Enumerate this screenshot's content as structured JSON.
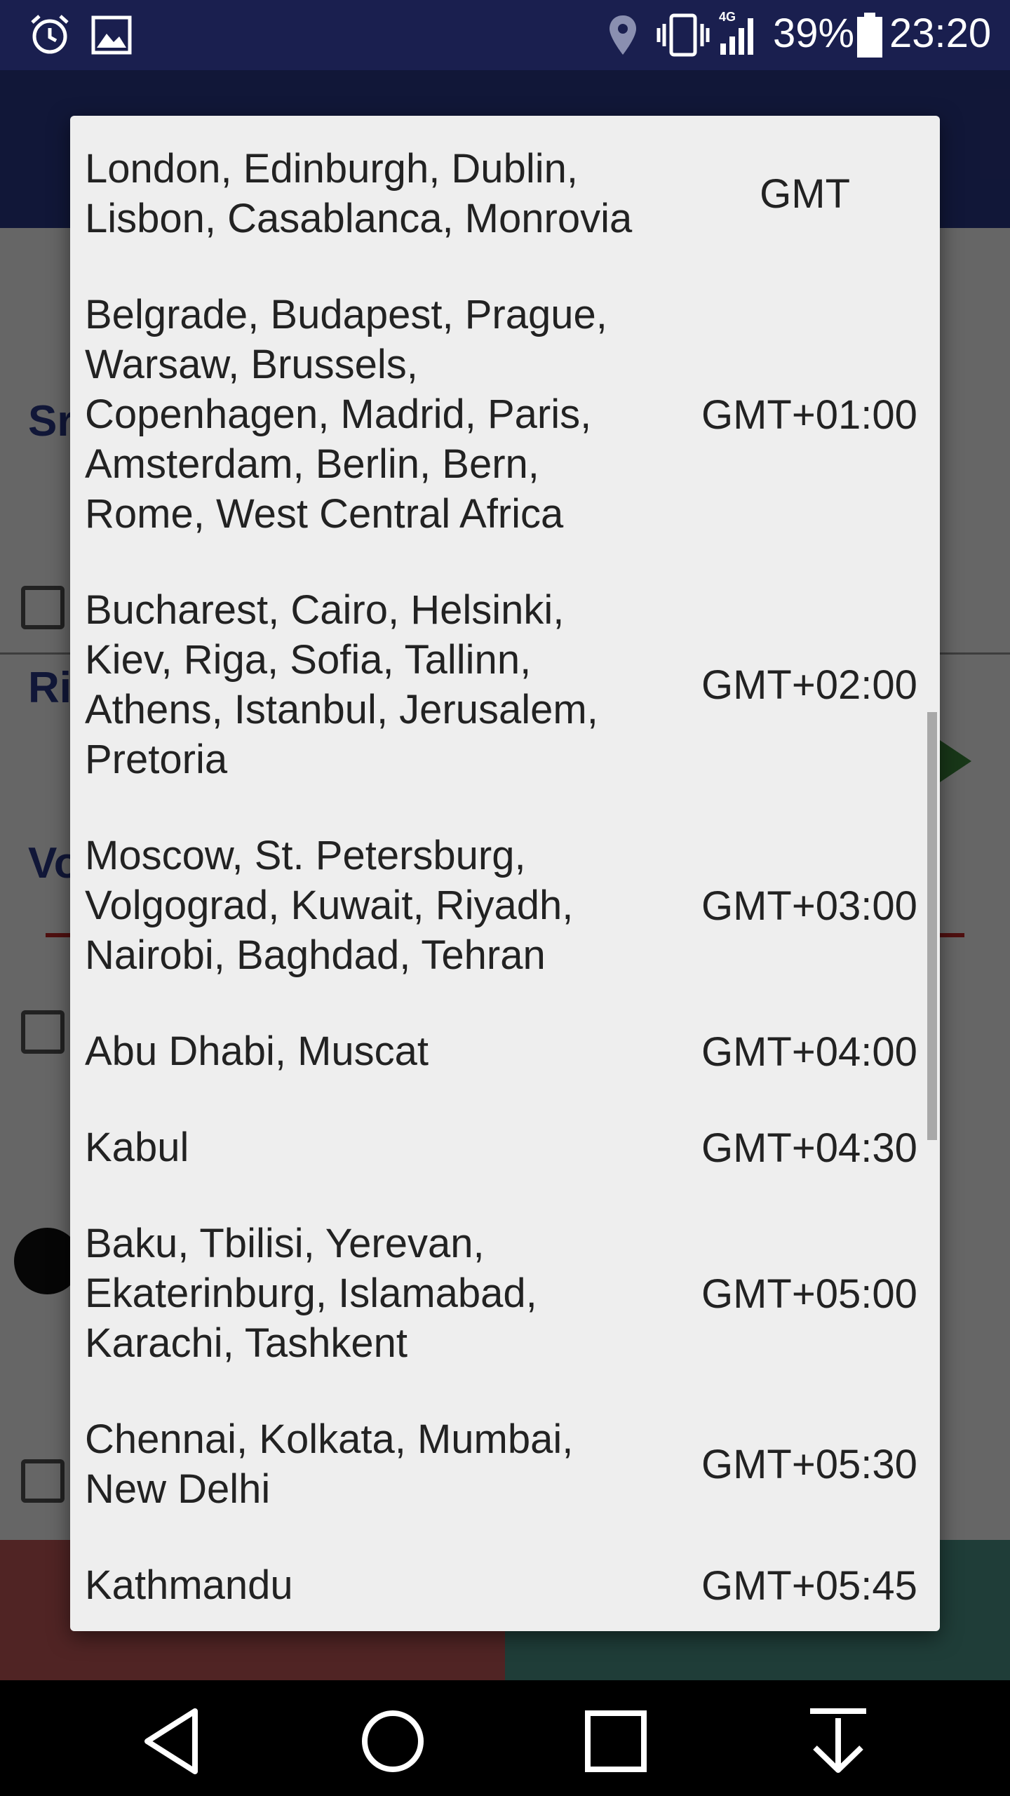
{
  "status_bar": {
    "left_icons": [
      "alarm-icon",
      "image-icon"
    ],
    "right_icons": [
      "location-icon",
      "vibrate-icon",
      "signal-4g-icon",
      "battery-icon"
    ],
    "network_label": "4G",
    "battery_percent": "39%",
    "time": "23:20"
  },
  "colors": {
    "status_bar": "#1a1f4f",
    "app_header": "#2c3a8c",
    "dialog_bg": "#eeeeee",
    "nav_bar": "#000000"
  },
  "timezone_list": {
    "items": [
      {
        "name": "London, Edinburgh, Dublin,\nLisbon, Casablanca, Monrovia",
        "offset": "GMT"
      },
      {
        "name": "Belgrade, Budapest, Prague,\nWarsaw, Brussels,\nCopenhagen, Madrid, Paris,\nAmsterdam, Berlin, Bern,\nRome, West Central Africa",
        "offset": "GMT+01:00"
      },
      {
        "name": "Bucharest, Cairo, Helsinki,\nKiev, Riga, Sofia, Tallinn,\nAthens, Istanbul, Jerusalem,\nPretoria",
        "offset": "GMT+02:00"
      },
      {
        "name": "Moscow, St. Petersburg,\nVolgograd, Kuwait, Riyadh,\nNairobi, Baghdad, Tehran",
        "offset": "GMT+03:00"
      },
      {
        "name": "Abu Dhabi, Muscat",
        "offset": "GMT+04:00"
      },
      {
        "name": "Kabul",
        "offset": "GMT+04:30"
      },
      {
        "name": "Baku, Tbilisi, Yerevan,\nEkaterinburg, Islamabad,\nKarachi, Tashkent",
        "offset": "GMT+05:00"
      },
      {
        "name": "Chennai, Kolkata, Mumbai,\nNew Delhi",
        "offset": "GMT+05:30"
      },
      {
        "name": "Kathmandu",
        "offset": "GMT+05:45"
      }
    ]
  },
  "nav_bar": {
    "buttons": [
      "back-icon",
      "home-icon",
      "recents-icon",
      "download-icon"
    ]
  }
}
